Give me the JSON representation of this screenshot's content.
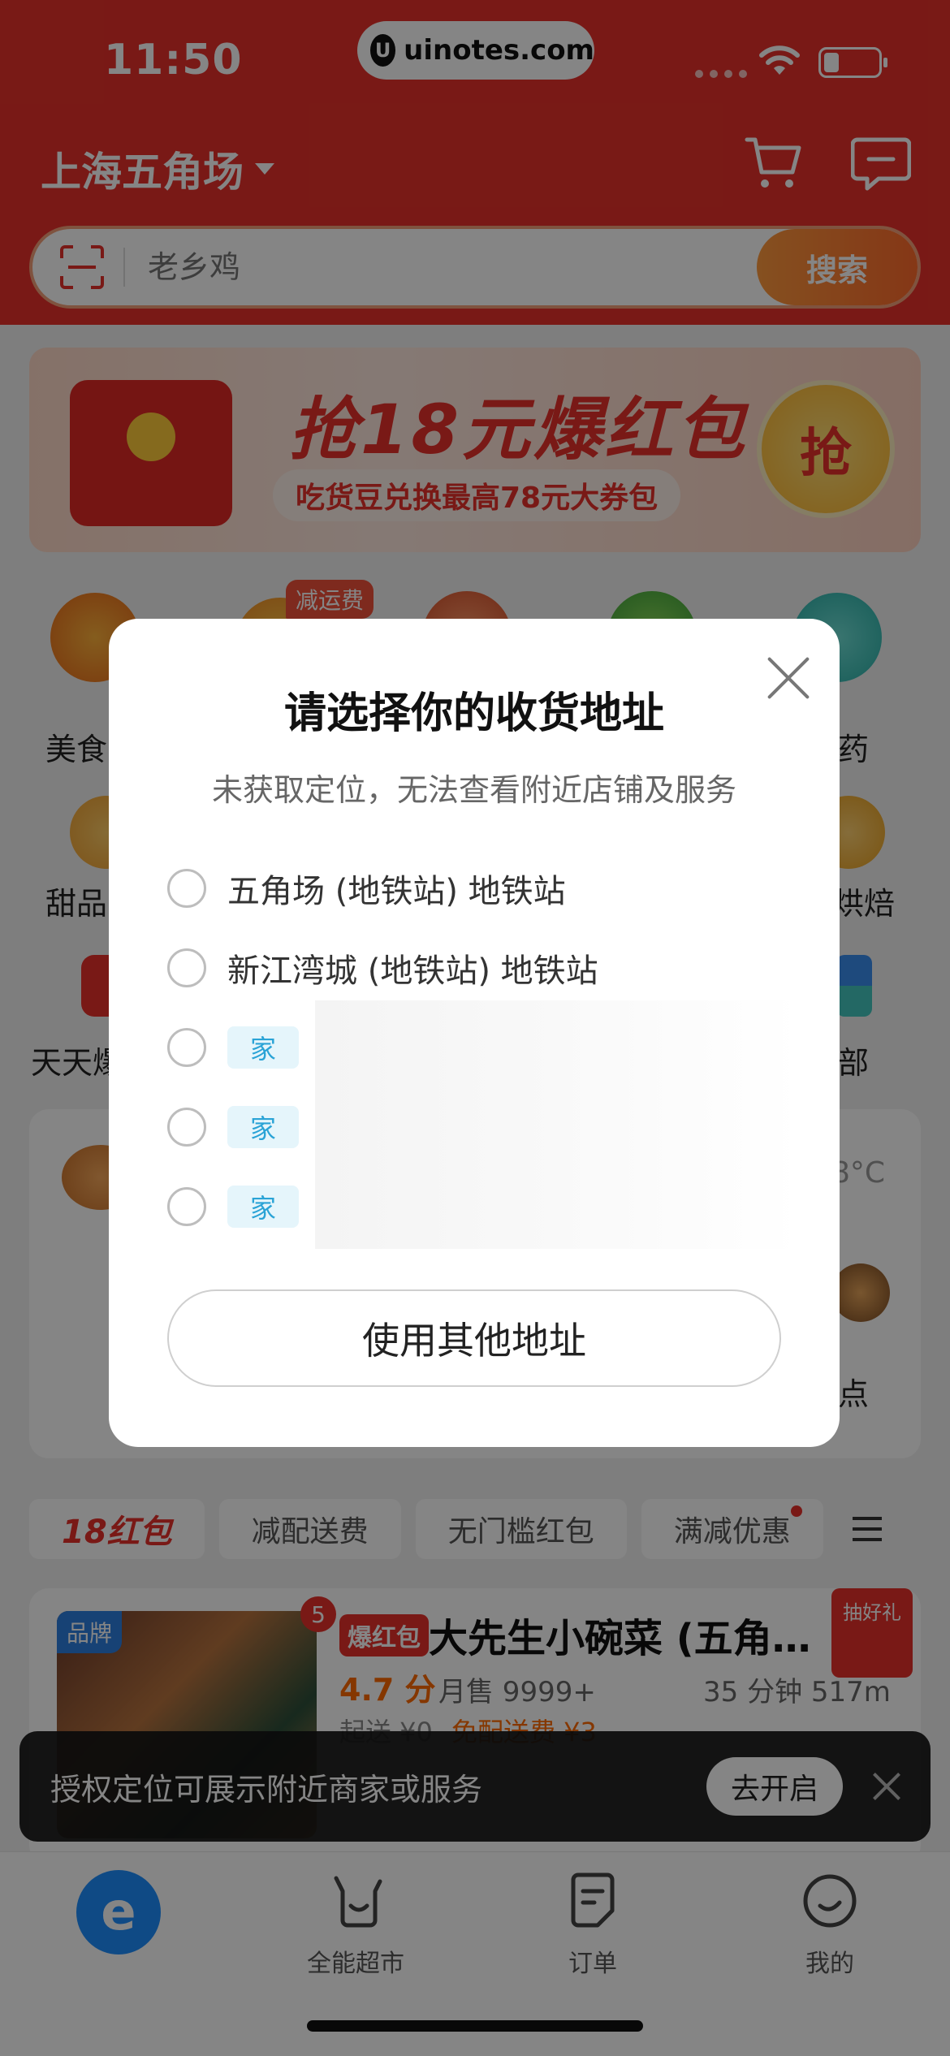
{
  "status_bar": {
    "time": "11:50",
    "url": "uinotes.com",
    "url_logo": "U"
  },
  "header": {
    "location": "上海五角场",
    "search_placeholder": "老乡鸡",
    "search_button": "搜索",
    "icons": [
      "scan-icon",
      "cart-icon",
      "message-icon"
    ],
    "accent_color": "#e8312b"
  },
  "banner": {
    "title": "抢18元爆红包",
    "subtitle": "吃货豆兑换最高78元大券包",
    "grab": "抢"
  },
  "categories": {
    "tag": "减运费",
    "items": [
      "美食",
      "药",
      "甜品",
      "烘焙",
      "天天爆",
      "部"
    ]
  },
  "weather": {
    "temp": "8°C"
  },
  "promo_partial": "点",
  "filters": {
    "items": [
      "18红包",
      "减配送费",
      "无门槛红包",
      "满减优惠"
    ]
  },
  "store": {
    "badge": "品牌",
    "count": "5",
    "tag": "爆红包",
    "name": "大先生小碗菜 (五角…",
    "rating": "4.7 分",
    "monthly_sales": "月售 9999+",
    "distance": "35 分钟 517m",
    "min_order": "起送 ¥0",
    "delivery_fee": "免配送费 ¥3",
    "gift": "抽好礼"
  },
  "toast": {
    "text": "授权定位可展示附近商家或服务",
    "button": "去开启"
  },
  "tabbar": {
    "items": [
      {
        "label": "",
        "icon": "eleme-home-icon"
      },
      {
        "label": "全能超市",
        "icon": "supermarket-icon"
      },
      {
        "label": "订单",
        "icon": "order-icon"
      },
      {
        "label": "我的",
        "icon": "profile-icon"
      }
    ]
  },
  "modal": {
    "title": "请选择你的收货地址",
    "subtitle": "未获取定位，无法查看附近店铺及服务",
    "addresses": [
      {
        "label": "五角场 (地铁站) 地铁站"
      },
      {
        "label": "新江湾城 (地铁站) 地铁站"
      },
      {
        "tag": "家"
      },
      {
        "tag": "家"
      },
      {
        "tag": "家"
      }
    ],
    "other_button": "使用其他地址"
  }
}
